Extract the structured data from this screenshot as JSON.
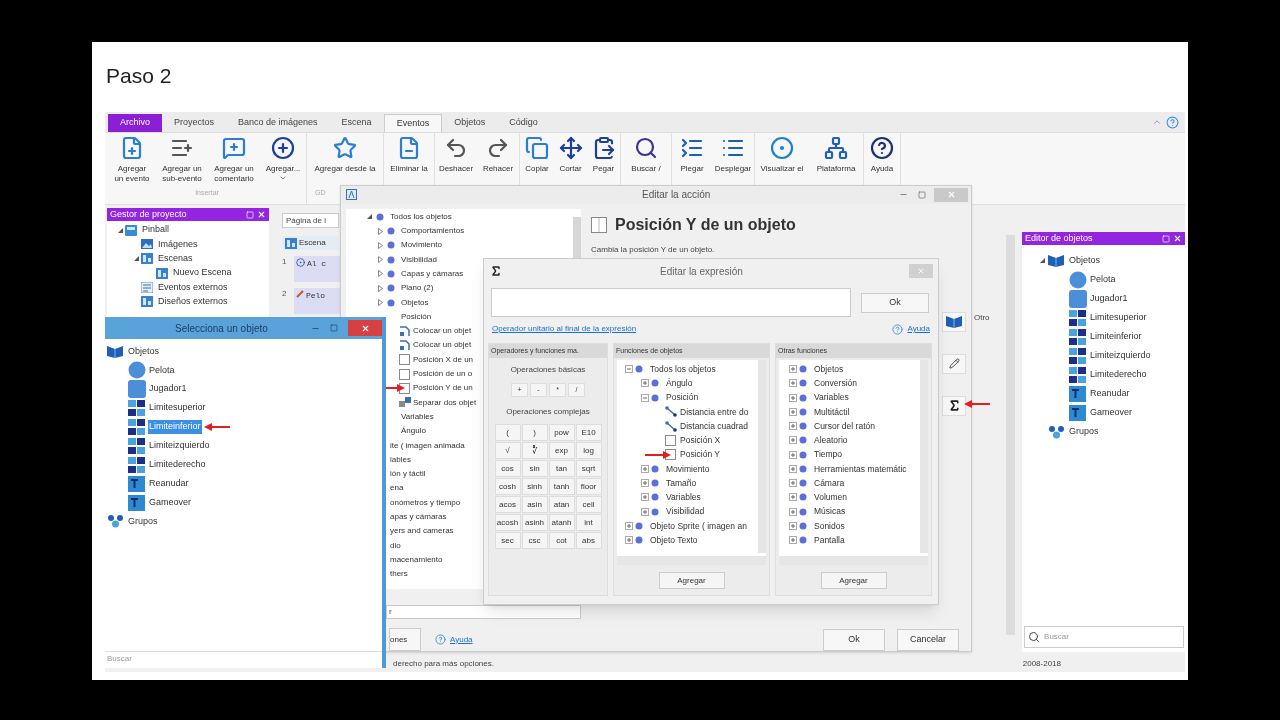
{
  "slide": {
    "title": "Paso 2"
  },
  "tabs": [
    {
      "label": "Archivo",
      "kind": "file"
    },
    {
      "label": "Proyectos",
      "kind": "tab",
      "selected": false
    },
    {
      "label": "Banco de imágenes",
      "kind": "tab",
      "selected": false
    },
    {
      "label": "Escena",
      "kind": "tab",
      "selected": false
    },
    {
      "label": "Eventos",
      "kind": "tab",
      "selected": true
    },
    {
      "label": "Objetos",
      "kind": "tab",
      "selected": false
    },
    {
      "label": "Código",
      "kind": "tab",
      "selected": false
    }
  ],
  "ribbon": [
    {
      "label": "Insertar",
      "buttons": [
        {
          "label": "Agregar\nun evento",
          "kind": "add-event"
        },
        {
          "label": "Agregar un\nsub-evento",
          "kind": "add-sub"
        },
        {
          "label": "Agregar un\ncomentario",
          "kind": "add-comment"
        },
        {
          "label": "Agregar...",
          "kind": "add-more"
        }
      ]
    },
    {
      "label": "GD",
      "buttons": [
        {
          "label": "Agregar desde la",
          "kind": "store"
        }
      ]
    },
    {
      "buttons": [
        {
          "label": "Eliminar la",
          "kind": "delete"
        }
      ]
    },
    {
      "buttons": [
        {
          "label": "Deshacer",
          "kind": "undo"
        },
        {
          "label": "Rehacer",
          "kind": "redo"
        }
      ]
    },
    {
      "buttons": [
        {
          "label": "Copiar",
          "kind": "copy"
        },
        {
          "label": "Cortar",
          "kind": "cut"
        },
        {
          "label": "Pegar",
          "kind": "paste"
        }
      ]
    },
    {
      "buttons": [
        {
          "label": "Buscar /",
          "kind": "search"
        }
      ]
    },
    {
      "buttons": [
        {
          "label": "Plegar",
          "kind": "fold"
        },
        {
          "label": "Desplegar",
          "kind": "unfold"
        }
      ]
    },
    {
      "buttons": [
        {
          "label": "Visualizar el",
          "kind": "preview"
        },
        {
          "label": "Plataforma",
          "kind": "platform"
        }
      ]
    },
    {
      "buttons": [
        {
          "label": "Ayuda",
          "kind": "help"
        }
      ]
    }
  ],
  "project_manager": {
    "title": "Gestor de proyecto",
    "tree": [
      {
        "label": "Pinball",
        "kind": "project",
        "expanded": true,
        "children": [
          {
            "label": "Imágenes",
            "kind": "images"
          },
          {
            "label": "Escenas",
            "kind": "scene",
            "expanded": true,
            "children": [
              {
                "label": "Nuevo Escena",
                "kind": "scene"
              }
            ]
          },
          {
            "label": "Eventos externos",
            "kind": "events"
          },
          {
            "label": "Diseños externos",
            "kind": "scene"
          }
        ]
      }
    ]
  },
  "events_area": {
    "tab": "Página de i",
    "scene_button": "Escena",
    "rows": [
      {
        "number": "1",
        "text": "Al c",
        "kind": "start"
      },
      {
        "number": "2",
        "text": "Pelo",
        "kind": "object"
      }
    ],
    "side_label": "Otro"
  },
  "object_editor": {
    "title": "Editor de objetos",
    "tree": [
      {
        "label": "Objetos",
        "kind": "objects",
        "expanded": true,
        "children": [
          {
            "label": "Pelota",
            "kind": "circle"
          },
          {
            "label": "Jugador1",
            "kind": "block"
          },
          {
            "label": "Limitesuperior",
            "kind": "tiles"
          },
          {
            "label": "Limiteinferior",
            "kind": "tiles"
          },
          {
            "label": "Limiteizquierdo",
            "kind": "tiles"
          },
          {
            "label": "Limitederecho",
            "kind": "tiles"
          },
          {
            "label": "Reanudar",
            "kind": "text"
          },
          {
            "label": "Gameover",
            "kind": "text"
          }
        ]
      },
      {
        "label": "Grupos",
        "kind": "groups"
      }
    ],
    "search": {
      "placeholder": "Buscar"
    }
  },
  "status_bar": {
    "left": "derecho para más opciones.",
    "right": "2008-2018"
  },
  "action_dialog": {
    "title": "Editar la acción",
    "tree": [
      {
        "label": "Todos los objetos",
        "kind": "category",
        "expanded": true,
        "children": [
          {
            "label": "Comportamientos",
            "kind": "category",
            "expanded": false
          },
          {
            "label": "Movimiento",
            "kind": "category",
            "expanded": false
          },
          {
            "label": "Visibilidad",
            "kind": "category",
            "expanded": false
          },
          {
            "label": "Capas y cámaras",
            "kind": "category",
            "expanded": false
          },
          {
            "label": "Plano (2)",
            "kind": "category",
            "expanded": false
          },
          {
            "label": "Objetos",
            "kind": "category",
            "expanded": false
          },
          {
            "label": "Posición",
            "children": [
              {
                "label": "Colocar un objet",
                "kind": "move"
              },
              {
                "label": "Colocar un objet",
                "kind": "move"
              },
              {
                "label": "Posición X de un",
                "kind": "box"
              },
              {
                "label": "Posición de un o",
                "kind": "box"
              },
              {
                "label": "Posición Y de un",
                "kind": "box",
                "marked": true
              },
              {
                "label": "Separar dos objet",
                "kind": "separate"
              }
            ]
          },
          {
            "label": "Variables"
          },
          {
            "label": "Ángulo"
          }
        ]
      },
      {
        "label": "ite ( imagen animada"
      },
      {
        "label": "iables"
      },
      {
        "label": "ión y táctil"
      },
      {
        "label": "ena"
      },
      {
        "label": "onómetros y tiempo"
      },
      {
        "label": "apas y cámaras"
      },
      {
        "label": "yers and cameras"
      },
      {
        "label": "dio"
      },
      {
        "label": "macenamiento"
      },
      {
        "label": "thers"
      }
    ],
    "heading": "Posición Y de un objeto",
    "description": "Cambia la posición Y de un objeto.",
    "side_buttons": [
      {
        "kind": "object"
      },
      {
        "kind": "pencil"
      },
      {
        "kind": "sigma",
        "marked": true
      }
    ],
    "search": {
      "value": "r"
    },
    "options_button": "ones",
    "help_link": "Ayuda",
    "buttons": [
      "Ok",
      "Cancelar"
    ]
  },
  "expression_dialog": {
    "title": "Editar la expresión",
    "ok": "Ok",
    "link": "Operador unitario al final de la expresión",
    "help": "Ayuda",
    "operators": {
      "header": "Operadores y funciones ma.",
      "basic_label": "Operaciones básicas",
      "basic": [
        "+",
        "-",
        "*",
        "/"
      ],
      "complex_label": "Operaciones complejas",
      "complex": [
        "(",
        ")",
        "pow",
        "E10",
        "√",
        "∛",
        "exp",
        "log",
        "cos",
        "sin",
        "tan",
        "sqrt",
        "cosh",
        "sinh",
        "tanh",
        "floor",
        "acos",
        "asin",
        "atan",
        "ceil",
        "acosh",
        "asinh",
        "atanh",
        "int",
        "sec",
        "csc",
        "cot",
        "abs"
      ]
    },
    "object_functions": {
      "header": "Funciones de objetos",
      "button": "Agregar",
      "tree": [
        {
          "label": "Todos los objetos",
          "kind": "category",
          "expanded": true,
          "children": [
            {
              "label": "Ángulo",
              "kind": "category",
              "expanded": false
            },
            {
              "label": "Posición",
              "kind": "category",
              "expanded": true,
              "children": [
                {
                  "label": "Distancia entre do",
                  "kind": "distance"
                },
                {
                  "label": "Distancia cuadrad",
                  "kind": "distance"
                },
                {
                  "label": "Posición X",
                  "kind": "box"
                },
                {
                  "label": "Posición Y",
                  "kind": "box",
                  "marked": true
                }
              ]
            },
            {
              "label": "Movimiento",
              "kind": "category",
              "expanded": false
            },
            {
              "label": "Tamaño",
              "kind": "category",
              "expanded": false
            },
            {
              "label": "Variables",
              "kind": "category",
              "expanded": false
            },
            {
              "label": "Visibilidad",
              "kind": "category",
              "expanded": false
            }
          ]
        },
        {
          "label": "Objeto Sprite ( imagen an",
          "kind": "category",
          "expanded": false
        },
        {
          "label": "Objeto Texto",
          "kind": "category",
          "expanded": false
        }
      ]
    },
    "other_functions": {
      "header": "Otras funciones",
      "button": "Agregar",
      "tree": [
        {
          "label": "Objetos",
          "kind": "category",
          "expanded": false
        },
        {
          "label": "Conversión",
          "kind": "category",
          "expanded": false
        },
        {
          "label": "Variables",
          "kind": "category",
          "expanded": false
        },
        {
          "label": "Multitáctil",
          "kind": "category",
          "expanded": false
        },
        {
          "label": "Cursor del ratón",
          "kind": "category",
          "expanded": false
        },
        {
          "label": "Aleatorio",
          "kind": "category",
          "expanded": false
        },
        {
          "label": "Tiempo",
          "kind": "category",
          "expanded": false
        },
        {
          "label": "Herramientas matemátic",
          "kind": "category",
          "expanded": false
        },
        {
          "label": "Cámara",
          "kind": "category",
          "expanded": false
        },
        {
          "label": "Volumen",
          "kind": "category",
          "expanded": false
        },
        {
          "label": "Músicas",
          "kind": "category",
          "expanded": false
        },
        {
          "label": "Sonidos",
          "kind": "category",
          "expanded": false
        },
        {
          "label": "Pantalla",
          "kind": "category",
          "expanded": false
        }
      ]
    }
  },
  "object_picker": {
    "title": "Selecciona un objeto",
    "tree": [
      {
        "label": "Objetos",
        "kind": "objects",
        "selected": false,
        "children": [
          {
            "label": "Pelota",
            "kind": "circle",
            "selected": false
          },
          {
            "label": "Jugador1",
            "kind": "block",
            "selected": false
          },
          {
            "label": "Limitesuperior",
            "kind": "tiles",
            "selected": false
          },
          {
            "label": "Limiteinferior",
            "kind": "tiles",
            "selected": true,
            "marked": true
          },
          {
            "label": "Limiteizquierdo",
            "kind": "tiles",
            "selected": false
          },
          {
            "label": "Limitederecho",
            "kind": "tiles",
            "selected": false
          },
          {
            "label": "Reanudar",
            "kind": "text",
            "selected": false
          },
          {
            "label": "Gameover",
            "kind": "text",
            "selected": false
          }
        ]
      },
      {
        "label": "Grupos",
        "kind": "groups",
        "selected": false
      }
    ],
    "search": {
      "placeholder": "Buscar"
    }
  }
}
